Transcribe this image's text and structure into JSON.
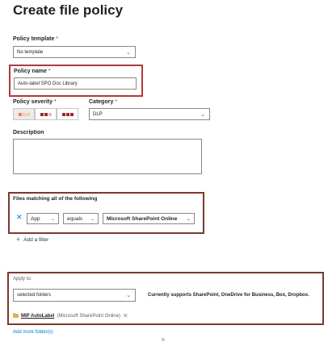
{
  "page": {
    "title": "Create file policy"
  },
  "policy_template": {
    "label": "Policy template",
    "required_mark": "*",
    "value": "No template"
  },
  "policy_name": {
    "label": "Policy name",
    "required_mark": "*",
    "value": "Auto-label SPO Doc Library"
  },
  "policy_severity": {
    "label": "Policy severity",
    "required_mark": "*",
    "selected_index": 0,
    "levels": [
      "low",
      "medium",
      "high"
    ]
  },
  "category": {
    "label": "Category",
    "required_mark": "*",
    "value": "DLP"
  },
  "description": {
    "label": "Description",
    "value": ""
  },
  "files_matching": {
    "title": "Files matching all of the following",
    "filter": {
      "field": "App",
      "operator": "equals",
      "value": "Microsoft SharePoint Online"
    },
    "add_filter_label": "Add a filter"
  },
  "apply_to": {
    "label": "Apply to:",
    "value": "selected folders",
    "note": "Currently supports SharePoint, OneDrive for Business, Box, Dropbox.",
    "folder": {
      "name": "MIP AutoLabel",
      "source": "(Microsoft SharePoint Online)"
    },
    "add_more_label": "Add more folder(s)"
  },
  "colors": {
    "accent": "#0078d4",
    "highlight_border": "#b03a3a",
    "severity_low": "#e8845a",
    "severity_high": "#a4262c"
  },
  "icons": [
    "chevron-down-icon",
    "close-icon",
    "plus-icon",
    "folder-icon"
  ]
}
